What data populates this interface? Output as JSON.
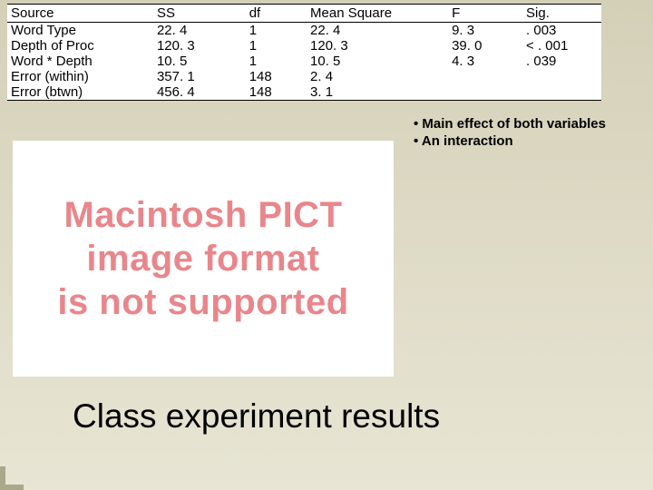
{
  "anova": {
    "headers": {
      "source": "Source",
      "ss": "SS",
      "df": "df",
      "ms": "Mean Square",
      "f": "F",
      "sig": "Sig."
    },
    "rows": [
      {
        "source": "Word Type",
        "ss": "22. 4",
        "df": "1",
        "ms": "22. 4",
        "f": "9. 3",
        "sig": ". 003"
      },
      {
        "source": "Depth of Proc",
        "ss": "120. 3",
        "df": "1",
        "ms": "120. 3",
        "f": "39. 0",
        "sig": "< . 001"
      },
      {
        "source": "Word * Depth",
        "ss": "10. 5",
        "df": "1",
        "ms": "10. 5",
        "f": "4. 3",
        "sig": ". 039"
      },
      {
        "source": "Error (within)",
        "ss": "357. 1",
        "df": "148",
        "ms": "2. 4",
        "f": "",
        "sig": ""
      },
      {
        "source": "Error (btwn)",
        "ss": "456. 4",
        "df": "148",
        "ms": "3. 1",
        "f": "",
        "sig": ""
      }
    ]
  },
  "notes": {
    "items": [
      "Main effect of both variables",
      "An interaction"
    ]
  },
  "pict": {
    "line1": "Macintosh PICT",
    "line2": "image format",
    "line3": "is not supported"
  },
  "title": "Class experiment results",
  "chart_data": {
    "type": "table",
    "title": "ANOVA results",
    "columns": [
      "Source",
      "SS",
      "df",
      "Mean Square",
      "F",
      "Sig."
    ],
    "rows": [
      [
        "Word Type",
        22.4,
        1,
        22.4,
        9.3,
        0.003
      ],
      [
        "Depth of Proc",
        120.3,
        1,
        120.3,
        39.0,
        "< .001"
      ],
      [
        "Word * Depth",
        10.5,
        1,
        10.5,
        4.3,
        0.039
      ],
      [
        "Error (within)",
        357.1,
        148,
        2.4,
        null,
        null
      ],
      [
        "Error (btwn)",
        456.4,
        148,
        3.1,
        null,
        null
      ]
    ]
  }
}
